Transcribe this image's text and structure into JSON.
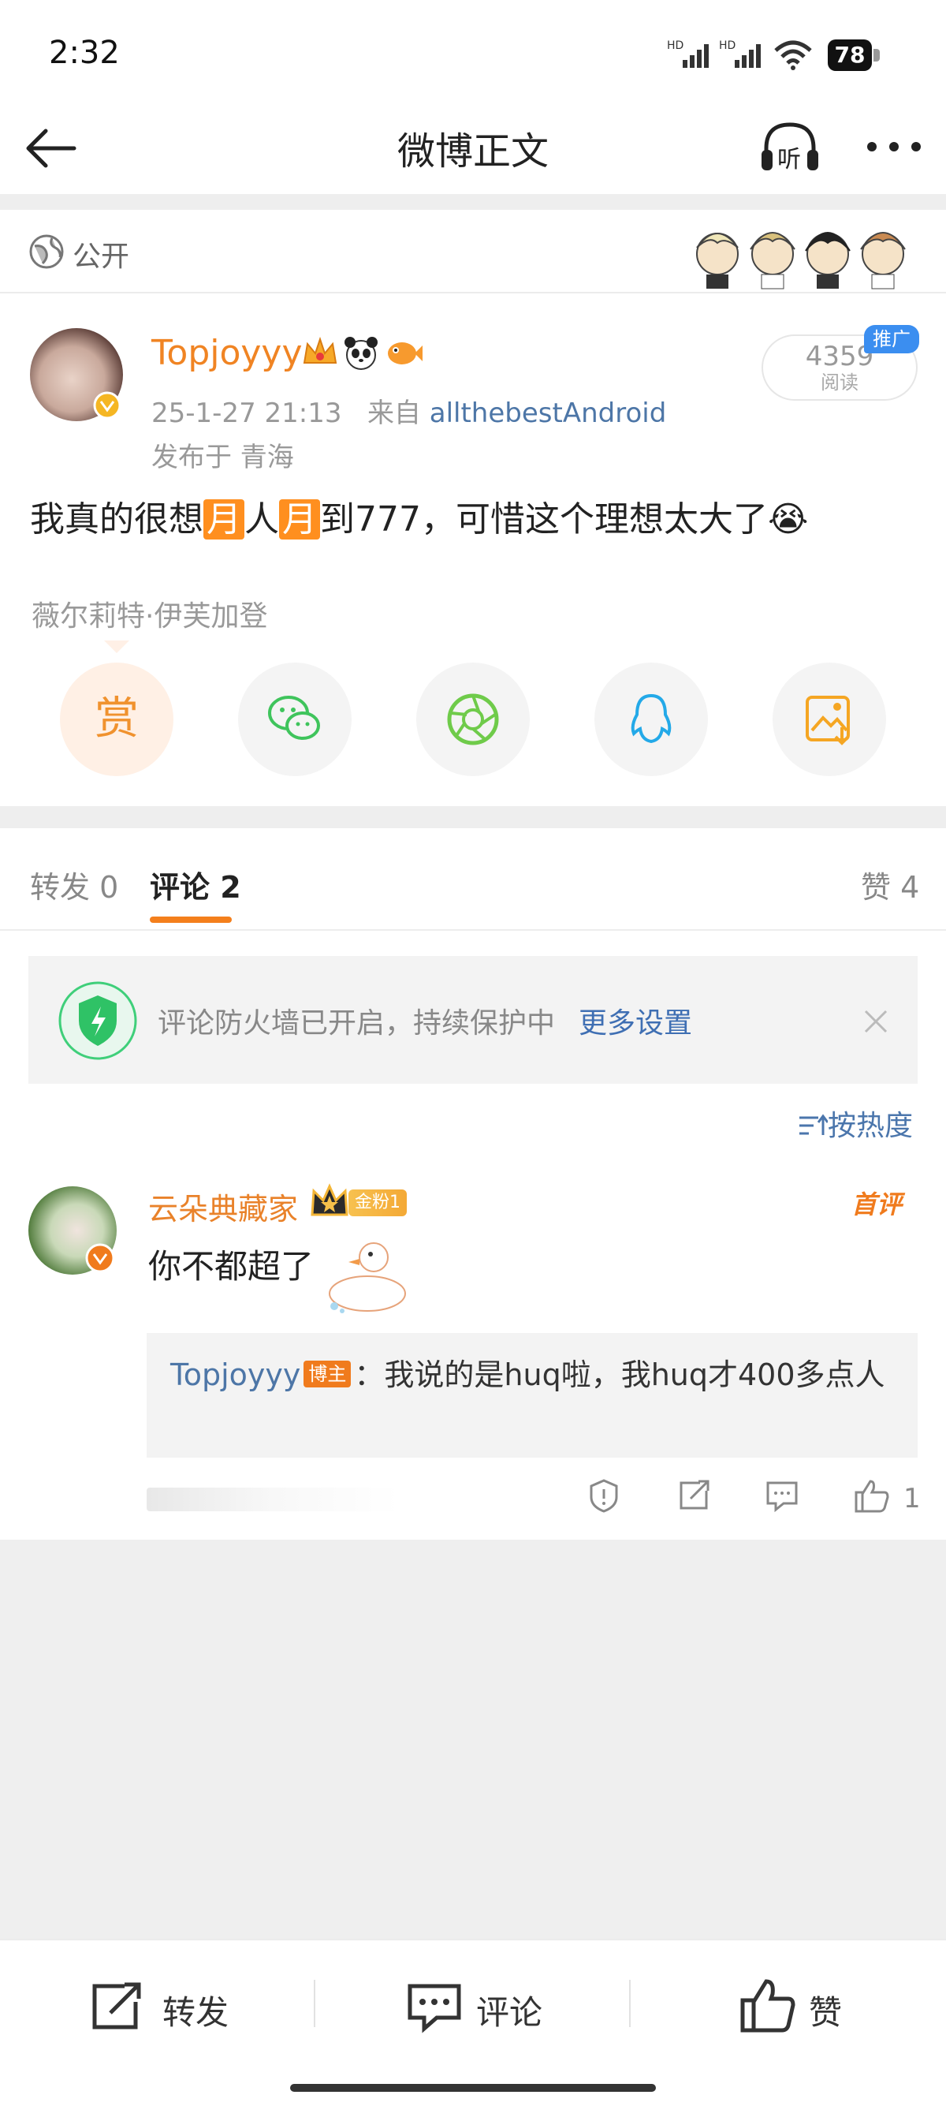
{
  "status_bar": {
    "time": "2:32",
    "battery": "78",
    "network1": "HD",
    "network2": "HD"
  },
  "nav": {
    "title": "微博正文",
    "listen_icon_label": "听"
  },
  "visibility": {
    "label": "公开"
  },
  "post": {
    "username": "Topjoyyy",
    "date": "25-1-27 21:13",
    "source_prefix": "来自",
    "source": "allthebestAndroid",
    "location": "发布于 青海",
    "reads": "4359",
    "reads_label": "阅读",
    "promo_badge": "推广",
    "content": {
      "part1": "我真的很想",
      "hl1": "月",
      "part2": "人",
      "hl2": "月",
      "part3": "到777，可惜这个理想太大了",
      "emoji": "😭"
    },
    "cosigner": "薇尔莉特·伊芙加登",
    "reward_label": "赏"
  },
  "tabs": {
    "repost": "转发 0",
    "comments": "评论 2",
    "likes": "赞 4"
  },
  "firewall": {
    "text": "评论防火墙已开启，持续保护中",
    "link": "更多设置"
  },
  "sort_label": "按热度",
  "comment": {
    "username": "云朵典藏家",
    "fan_badge": "金粉1",
    "first_badge": "首评",
    "text": "你不都超了",
    "reply_user": "Topjoyyy",
    "reply_badge": "博主",
    "reply_text": "：我说的是huq啦，我huq才400多点人",
    "like_count": "1"
  },
  "bottom_bar": {
    "repost": "转发",
    "comment": "评论",
    "like": "赞"
  },
  "colors": {
    "accent_orange": "#f08423",
    "link_blue": "#4d76a7",
    "promo_blue": "#3b8ef0"
  }
}
